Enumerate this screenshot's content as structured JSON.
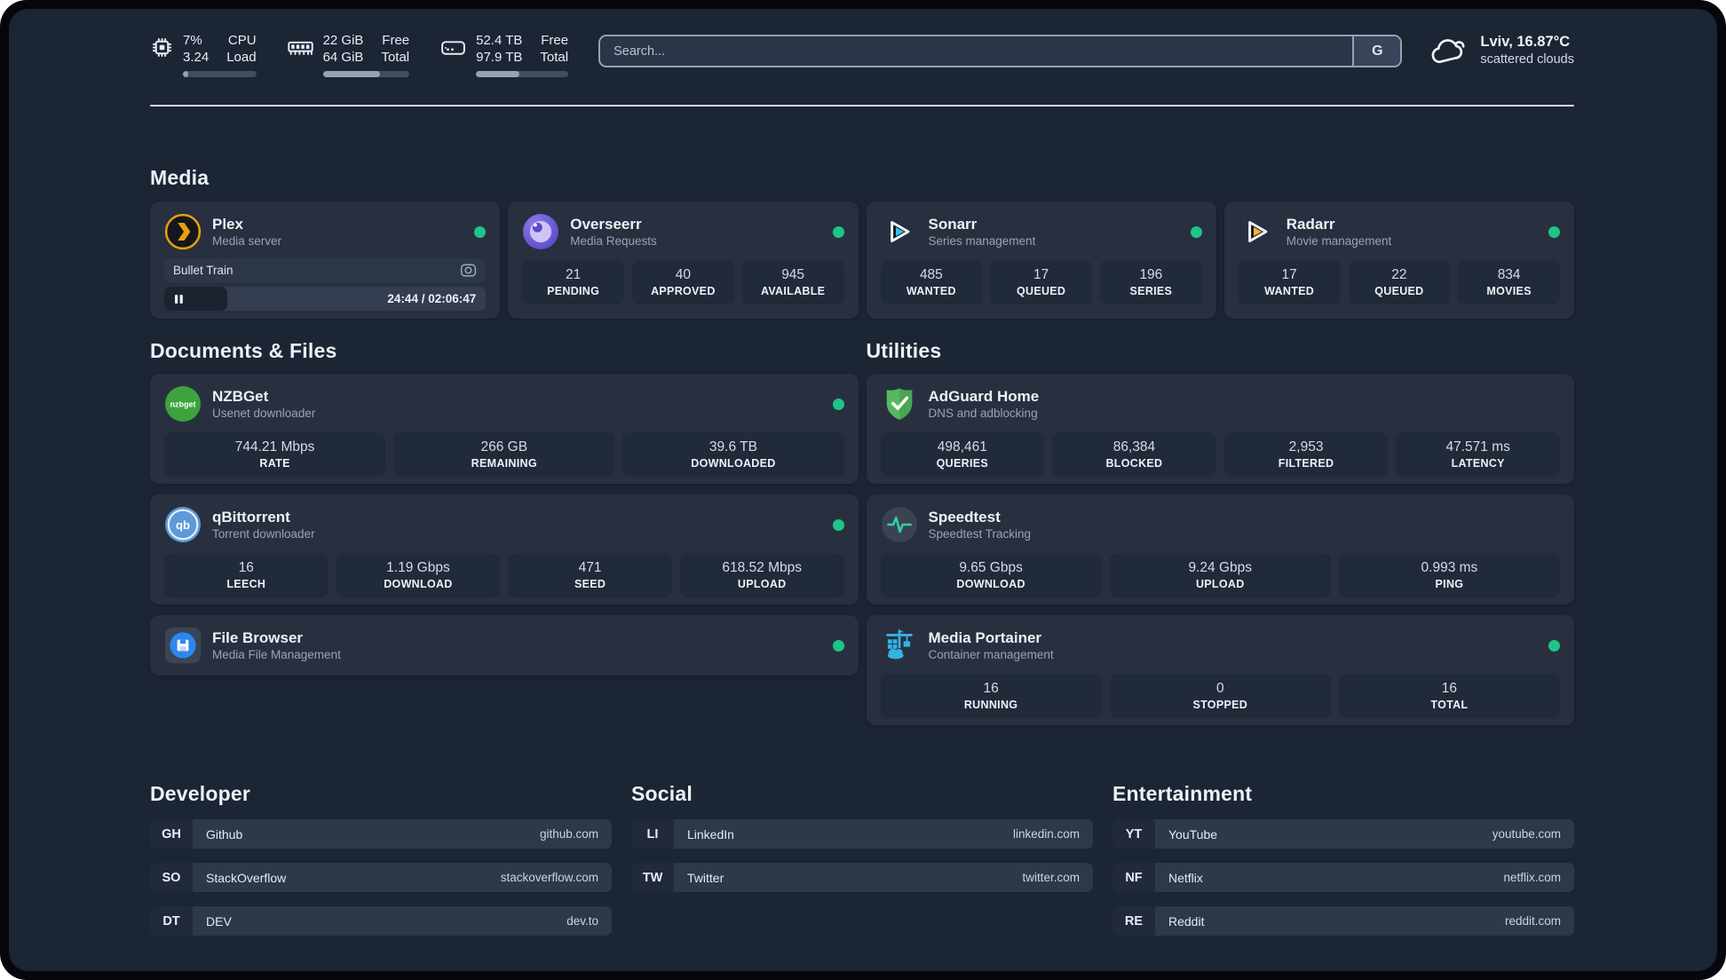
{
  "colors": {
    "status_online": "#1fc487",
    "plex_gold": "#e5a00d",
    "overseerr_purple": "#5a49c8",
    "overseerr_iris": "#cfc5f5",
    "sonarr_blue": "#36c2ee",
    "radarr_yellow": "#f7b530",
    "nzbget_green": "#3da33c",
    "qbittorrent_blue": "#5d9ad9",
    "filebrowser_blue": "#2e86ef",
    "adguard_green": "#57b85f",
    "speedtest_pulse": "#2ed3a3",
    "portainer_blue": "#34b3e4"
  },
  "header": {
    "metrics": {
      "cpu": {
        "values": [
          "7%",
          "3.24"
        ],
        "labels": [
          "CPU",
          "Load"
        ],
        "percent": 7
      },
      "memory": {
        "values": [
          "22 GiB",
          "64 GiB"
        ],
        "labels": [
          "Free",
          "Total"
        ],
        "percent": 66
      },
      "storage": {
        "values": [
          "52.4 TB",
          "97.9 TB"
        ],
        "labels": [
          "Free",
          "Total"
        ],
        "percent": 47
      }
    },
    "search": {
      "placeholder": "Search...",
      "engine_button_label": "G"
    },
    "weather": {
      "location_temperature": "Lviv, 16.87°C",
      "condition": "scattered clouds"
    }
  },
  "sections": {
    "media": {
      "title": "Media",
      "plex": {
        "name": "Plex",
        "description": "Media server",
        "now_playing": {
          "title": "Bullet Train",
          "time_display": "24:44 / 02:06:47",
          "progress_percent": 19.5,
          "state": "paused"
        }
      },
      "overseerr": {
        "name": "Overseerr",
        "description": "Media Requests",
        "stats": [
          {
            "value": "21",
            "label": "PENDING"
          },
          {
            "value": "40",
            "label": "APPROVED"
          },
          {
            "value": "945",
            "label": "AVAILABLE"
          }
        ]
      },
      "sonarr": {
        "name": "Sonarr",
        "description": "Series management",
        "stats": [
          {
            "value": "485",
            "label": "WANTED"
          },
          {
            "value": "17",
            "label": "QUEUED"
          },
          {
            "value": "196",
            "label": "SERIES"
          }
        ]
      },
      "radarr": {
        "name": "Radarr",
        "description": "Movie management",
        "stats": [
          {
            "value": "17",
            "label": "WANTED"
          },
          {
            "value": "22",
            "label": "QUEUED"
          },
          {
            "value": "834",
            "label": "MOVIES"
          }
        ]
      }
    },
    "documents_files": {
      "title": "Documents & Files",
      "nzbget": {
        "name": "NZBGet",
        "description": "Usenet downloader",
        "icon_text": "nzbget",
        "stats": [
          {
            "value": "744.21 Mbps",
            "label": "RATE"
          },
          {
            "value": "266 GB",
            "label": "REMAINING"
          },
          {
            "value": "39.6 TB",
            "label": "DOWNLOADED"
          }
        ]
      },
      "qbittorrent": {
        "name": "qBittorrent",
        "description": "Torrent downloader",
        "icon_text": "qb",
        "stats": [
          {
            "value": "16",
            "label": "LEECH"
          },
          {
            "value": "1.19 Gbps",
            "label": "DOWNLOAD"
          },
          {
            "value": "471",
            "label": "SEED"
          },
          {
            "value": "618.52 Mbps",
            "label": "UPLOAD"
          }
        ]
      },
      "file_browser": {
        "name": "File Browser",
        "description": "Media File Management"
      }
    },
    "utilities": {
      "title": "Utilities",
      "adguard_home": {
        "name": "AdGuard Home",
        "description": "DNS and adblocking",
        "stats": [
          {
            "value": "498,461",
            "label": "QUERIES"
          },
          {
            "value": "86,384",
            "label": "BLOCKED"
          },
          {
            "value": "2,953",
            "label": "FILTERED"
          },
          {
            "value": "47.571 ms",
            "label": "LATENCY"
          }
        ]
      },
      "speedtest": {
        "name": "Speedtest",
        "description": "Speedtest Tracking",
        "stats": [
          {
            "value": "9.65 Gbps",
            "label": "DOWNLOAD"
          },
          {
            "value": "9.24 Gbps",
            "label": "UPLOAD"
          },
          {
            "value": "0.993 ms",
            "label": "PING"
          }
        ]
      },
      "portainer": {
        "name": "Media Portainer",
        "description": "Container management",
        "stats": [
          {
            "value": "16",
            "label": "RUNNING"
          },
          {
            "value": "0",
            "label": "STOPPED"
          },
          {
            "value": "16",
            "label": "TOTAL"
          }
        ]
      }
    },
    "bookmarks": [
      {
        "title": "Developer",
        "links": [
          {
            "abbr": "GH",
            "name": "Github",
            "url": "github.com"
          },
          {
            "abbr": "SO",
            "name": "StackOverflow",
            "url": "stackoverflow.com"
          },
          {
            "abbr": "DT",
            "name": "DEV",
            "url": "dev.to"
          }
        ]
      },
      {
        "title": "Social",
        "links": [
          {
            "abbr": "LI",
            "name": "LinkedIn",
            "url": "linkedin.com"
          },
          {
            "abbr": "TW",
            "name": "Twitter",
            "url": "twitter.com"
          }
        ]
      },
      {
        "title": "Entertainment",
        "links": [
          {
            "abbr": "YT",
            "name": "YouTube",
            "url": "youtube.com"
          },
          {
            "abbr": "NF",
            "name": "Netflix",
            "url": "netflix.com"
          },
          {
            "abbr": "RE",
            "name": "Reddit",
            "url": "reddit.com"
          }
        ]
      }
    ]
  }
}
